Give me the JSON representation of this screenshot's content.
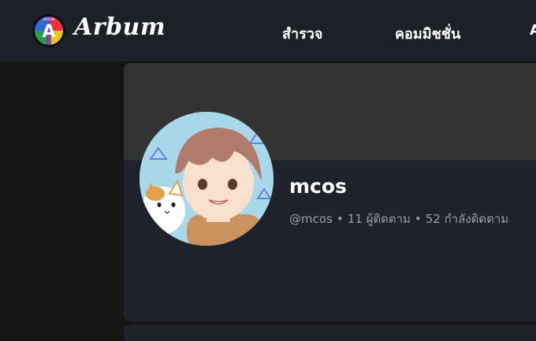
{
  "app": {
    "name": "Arbum",
    "logo_small_text": "ARBUM"
  },
  "nav": {
    "items": [
      {
        "label": "สำรวจ"
      },
      {
        "label": "คอมมิชชั่น"
      },
      {
        "label": "A"
      }
    ]
  },
  "profile": {
    "display_name": "mcos",
    "handle": "@mcos",
    "followers": "11 ผู้ติดตาม",
    "following": "52 กำลังติดตาม",
    "separator": "•"
  },
  "colors": {
    "topbar": "#1d2027",
    "page_bg": "#151515",
    "card_bg": "#1f222a",
    "cover_bg": "#333333",
    "text_primary": "#ffffff",
    "text_secondary": "#9b9ea6"
  }
}
